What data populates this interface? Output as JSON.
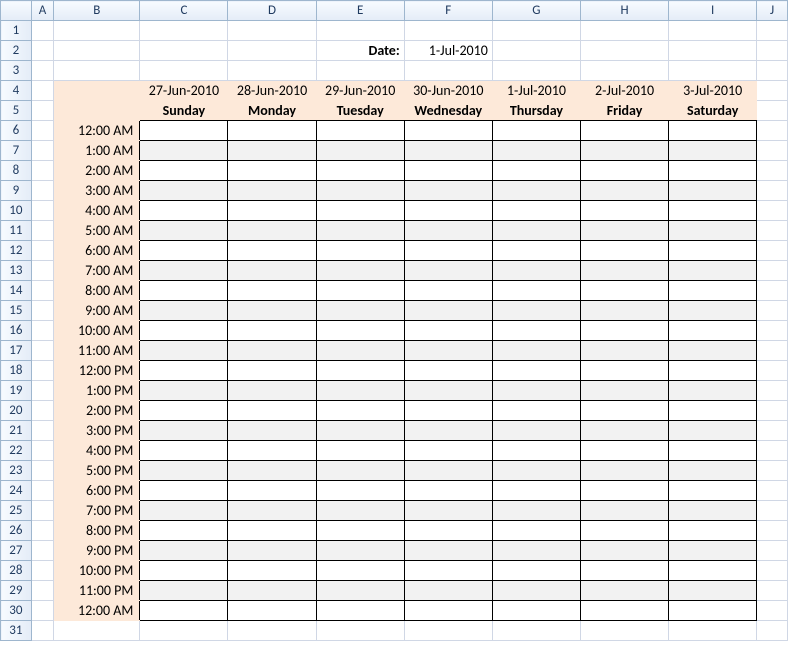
{
  "columns": [
    "A",
    "B",
    "C",
    "D",
    "E",
    "F",
    "G",
    "H",
    "I",
    "J"
  ],
  "date_label": "Date:",
  "date_value": "1-Jul-2010",
  "header_dates": [
    "27-Jun-2010",
    "28-Jun-2010",
    "29-Jun-2010",
    "30-Jun-2010",
    "1-Jul-2010",
    "2-Jul-2010",
    "3-Jul-2010"
  ],
  "header_days": [
    "Sunday",
    "Monday",
    "Tuesday",
    "Wednesday",
    "Thursday",
    "Friday",
    "Saturday"
  ],
  "times": [
    "12:00 AM",
    "1:00 AM",
    "2:00 AM",
    "3:00 AM",
    "4:00 AM",
    "5:00 AM",
    "6:00 AM",
    "7:00 AM",
    "8:00 AM",
    "9:00 AM",
    "10:00 AM",
    "11:00 AM",
    "12:00 PM",
    "1:00 PM",
    "2:00 PM",
    "3:00 PM",
    "4:00 PM",
    "5:00 PM",
    "6:00 PM",
    "7:00 PM",
    "8:00 PM",
    "9:00 PM",
    "10:00 PM",
    "11:00 PM",
    "12:00 AM"
  ],
  "row_numbers": [
    "1",
    "2",
    "3",
    "4",
    "5",
    "6",
    "7",
    "8",
    "9",
    "10",
    "11",
    "12",
    "13",
    "14",
    "15",
    "16",
    "17",
    "18",
    "19",
    "20",
    "21",
    "22",
    "23",
    "24",
    "25",
    "26",
    "27",
    "28",
    "29",
    "30",
    "31"
  ]
}
